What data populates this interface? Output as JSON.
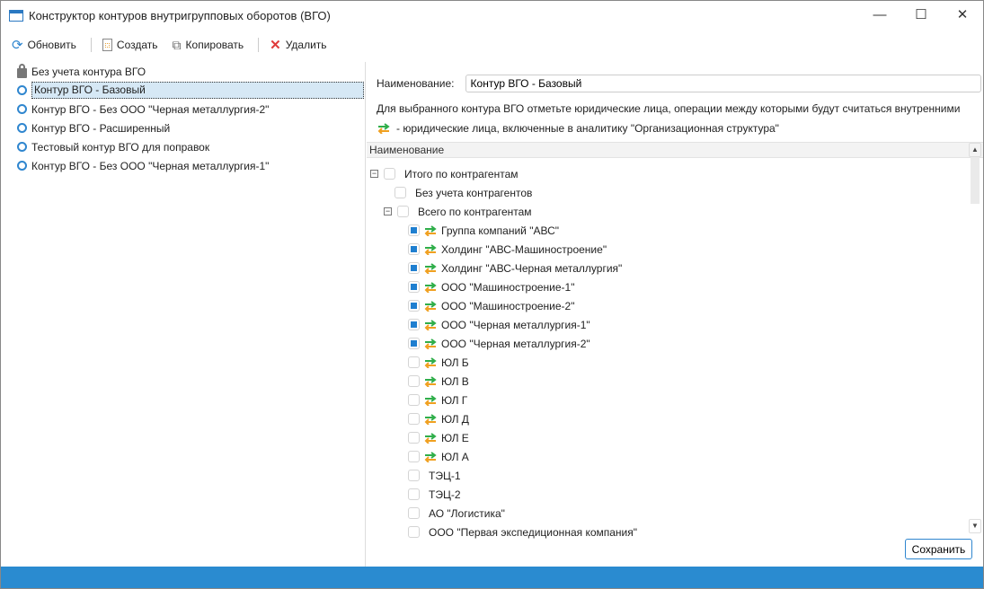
{
  "window": {
    "title": "Конструктор контуров внутригрупповых оборотов (ВГО)",
    "minimize": "—",
    "maximize": "☐",
    "close": "✕"
  },
  "toolbar": {
    "refresh": "Обновить",
    "create": "Создать",
    "copy": "Копировать",
    "delete": "Удалить"
  },
  "contours": [
    {
      "label": "Без учета контура ВГО",
      "icon": "lock-icon"
    },
    {
      "label": "Контур ВГО - Базовый",
      "selected": true
    },
    {
      "label": "Контур ВГО - Без ООО \"Черная металлургия-2\""
    },
    {
      "label": "Контур ВГО - Расширенный"
    },
    {
      "label": "Тестовый контур ВГО для поправок"
    },
    {
      "label": "Контур ВГО - Без ООО \"Черная металлургия-1\""
    }
  ],
  "details": {
    "name_label": "Наименование:",
    "name_value": "Контур ВГО - Базовый",
    "hint": "Для выбранного контура ВГО отметьте юридические лица, операции между которыми будут считаться внутренними",
    "legend": "- юридические лица, включенные в аналитику \"Организационная структура\"",
    "column_header": "Наименование",
    "tree": [
      {
        "label": "Итого по контрагентам",
        "level": 0,
        "expander": "−",
        "checked": false
      },
      {
        "label": "Без учета контрагентов",
        "level": 1,
        "checked": false
      },
      {
        "label": "Всего по контрагентам",
        "level": 1,
        "expander": "−",
        "checked": false
      },
      {
        "label": "Группа компаний \"АВС\"",
        "level": 2,
        "checked": true,
        "org": true
      },
      {
        "label": "Холдинг \"АВС-Машиностроение\"",
        "level": 2,
        "checked": true,
        "org": true
      },
      {
        "label": "Холдинг \"АВС-Черная металлургия\"",
        "level": 2,
        "checked": true,
        "org": true
      },
      {
        "label": "ООО \"Машиностроение-1\"",
        "level": 2,
        "checked": true,
        "org": true
      },
      {
        "label": "ООО \"Машиностроение-2\"",
        "level": 2,
        "checked": true,
        "org": true
      },
      {
        "label": "ООО \"Черная металлургия-1\"",
        "level": 2,
        "checked": true,
        "org": true
      },
      {
        "label": "ООО \"Черная металлургия-2\"",
        "level": 2,
        "checked": true,
        "org": true
      },
      {
        "label": "ЮЛ Б",
        "level": 2,
        "checked": false,
        "org": true
      },
      {
        "label": "ЮЛ В",
        "level": 2,
        "checked": false,
        "org": true
      },
      {
        "label": "ЮЛ Г",
        "level": 2,
        "checked": false,
        "org": true
      },
      {
        "label": "ЮЛ Д",
        "level": 2,
        "checked": false,
        "org": true
      },
      {
        "label": "ЮЛ Е",
        "level": 2,
        "checked": false,
        "org": true
      },
      {
        "label": "ЮЛ А",
        "level": 2,
        "checked": false,
        "org": true
      },
      {
        "label": "ТЭЦ-1",
        "level": 2,
        "checked": false
      },
      {
        "label": "ТЭЦ-2",
        "level": 2,
        "checked": false
      },
      {
        "label": "АО \"Логистика\"",
        "level": 2,
        "checked": false
      },
      {
        "label": "ООО \"Первая экспедиционная компания\"",
        "level": 2,
        "checked": false
      }
    ],
    "save": "Сохранить"
  }
}
